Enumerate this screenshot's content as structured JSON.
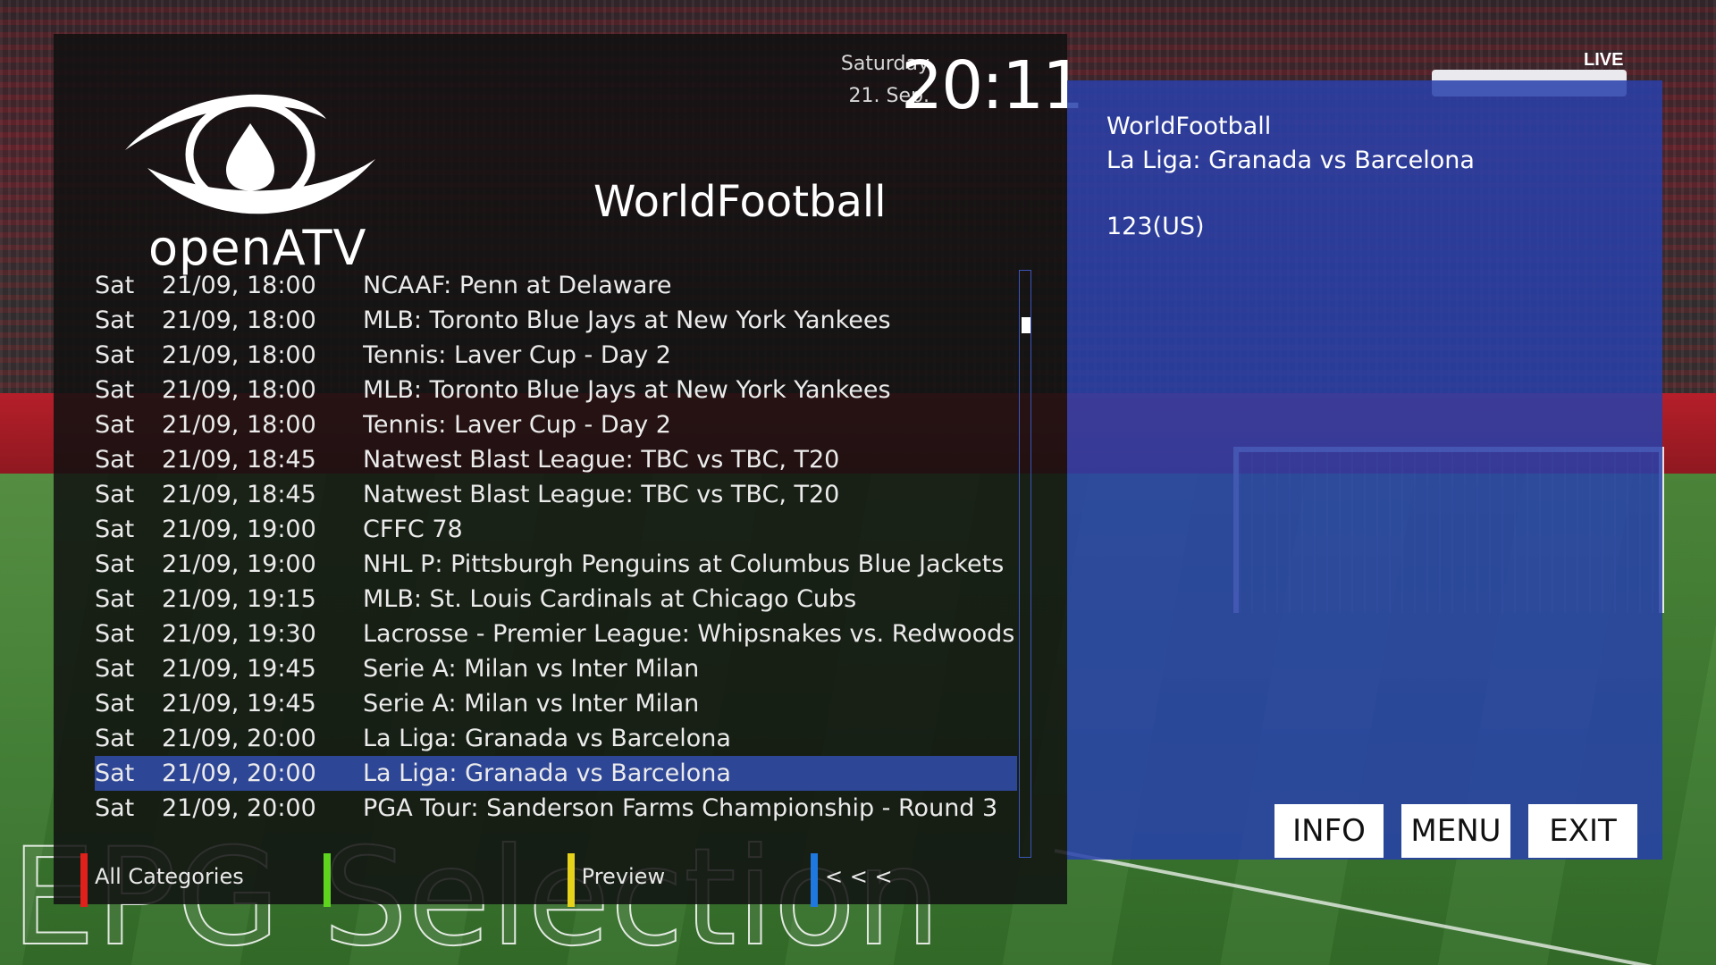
{
  "screen_title": "EPG Selection",
  "header": {
    "logo_text": "openATV",
    "day_name": "Saturday",
    "date": "21. Sep.",
    "clock": "20:11",
    "channel": "WorldFootball"
  },
  "background": {
    "live_badge": "LIVE"
  },
  "epg_list": [
    {
      "day": "Sat",
      "time": "21/09, 18:00",
      "title": "NCAAF: Penn at Delaware"
    },
    {
      "day": "Sat",
      "time": "21/09, 18:00",
      "title": "MLB: Toronto Blue Jays at New York Yankees"
    },
    {
      "day": "Sat",
      "time": "21/09, 18:00",
      "title": "Tennis: Laver Cup - Day 2"
    },
    {
      "day": "Sat",
      "time": "21/09, 18:00",
      "title": "MLB: Toronto Blue Jays at New York Yankees"
    },
    {
      "day": "Sat",
      "time": "21/09, 18:00",
      "title": "Tennis: Laver Cup - Day 2"
    },
    {
      "day": "Sat",
      "time": "21/09, 18:45",
      "title": "Natwest Blast League: TBC vs TBC, T20"
    },
    {
      "day": "Sat",
      "time": "21/09, 18:45",
      "title": "Natwest Blast League: TBC vs TBC, T20"
    },
    {
      "day": "Sat",
      "time": "21/09, 19:00",
      "title": "CFFC 78"
    },
    {
      "day": "Sat",
      "time": "21/09, 19:00",
      "title": "NHL P: Pittsburgh Penguins at Columbus Blue Jackets"
    },
    {
      "day": "Sat",
      "time": "21/09, 19:15",
      "title": "MLB: St. Louis Cardinals at Chicago Cubs"
    },
    {
      "day": "Sat",
      "time": "21/09, 19:30",
      "title": "Lacrosse - Premier League: Whipsnakes vs. Redwoods"
    },
    {
      "day": "Sat",
      "time": "21/09, 19:45",
      "title": "Serie A: Milan vs Inter Milan"
    },
    {
      "day": "Sat",
      "time": "21/09, 19:45",
      "title": "Serie A: Milan vs Inter Milan"
    },
    {
      "day": "Sat",
      "time": "21/09, 20:00",
      "title": "La Liga: Granada vs Barcelona"
    },
    {
      "day": "Sat",
      "time": "21/09, 20:00",
      "title": "La Liga: Granada vs Barcelona",
      "selected": true
    },
    {
      "day": "Sat",
      "time": "21/09, 20:00",
      "title": "PGA Tour: Sanderson Farms Championship - Round 3"
    }
  ],
  "color_keys": [
    {
      "color": "#e0201b",
      "label": "All Categories"
    },
    {
      "color": "#5fd41f",
      "label": ""
    },
    {
      "color": "#e6d21a",
      "label": "Preview"
    },
    {
      "color": "#1f78e0",
      "label": "< < <"
    }
  ],
  "info": {
    "channel": "WorldFootball",
    "event": "La Liga: Granada vs Barcelona",
    "extra": "123(US)"
  },
  "buttons": {
    "info": "INFO",
    "menu": "MENU",
    "exit": "EXIT"
  }
}
